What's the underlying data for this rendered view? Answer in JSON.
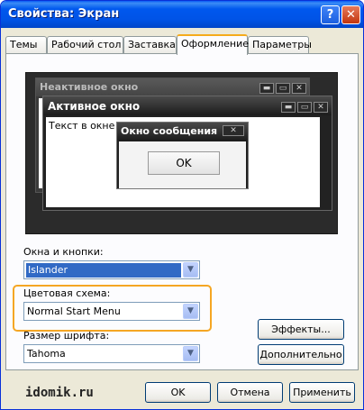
{
  "window": {
    "title": "Свойства: Экран",
    "help_glyph": "?",
    "close_glyph": "✕"
  },
  "tabs": [
    {
      "label": "Темы"
    },
    {
      "label": "Рабочий стол"
    },
    {
      "label": "Заставка"
    },
    {
      "label": "Оформление",
      "active": true
    },
    {
      "label": "Параметры"
    }
  ],
  "preview": {
    "inactive_title": "Неактивное окно",
    "active_title": "Активное окно",
    "window_text": "Текст в окне",
    "message_title": "Окно сообщения",
    "message_ok": "OK",
    "caption_buttons": [
      "▬",
      "▭",
      "✕"
    ],
    "msg_close_glyph": "✕"
  },
  "fields": {
    "windows_buttons": {
      "label": "Окна и кнопки:",
      "value": "Islander"
    },
    "color_scheme": {
      "label": "Цветовая схема:",
      "value": "Normal Start Menu"
    },
    "font_size": {
      "label": "Размер шрифта:",
      "value": "Tahoma"
    }
  },
  "side_buttons": {
    "effects": "Эффекты...",
    "advanced": "Дополнительно"
  },
  "footer": {
    "ok": "OK",
    "cancel": "Отмена",
    "apply": "Применить",
    "watermark": "idomik.ru"
  },
  "colors": {
    "titlebar": "#0058ee",
    "highlight": "#f5a623",
    "selection": "#316ac5",
    "window_bg": "#ece9d8"
  }
}
